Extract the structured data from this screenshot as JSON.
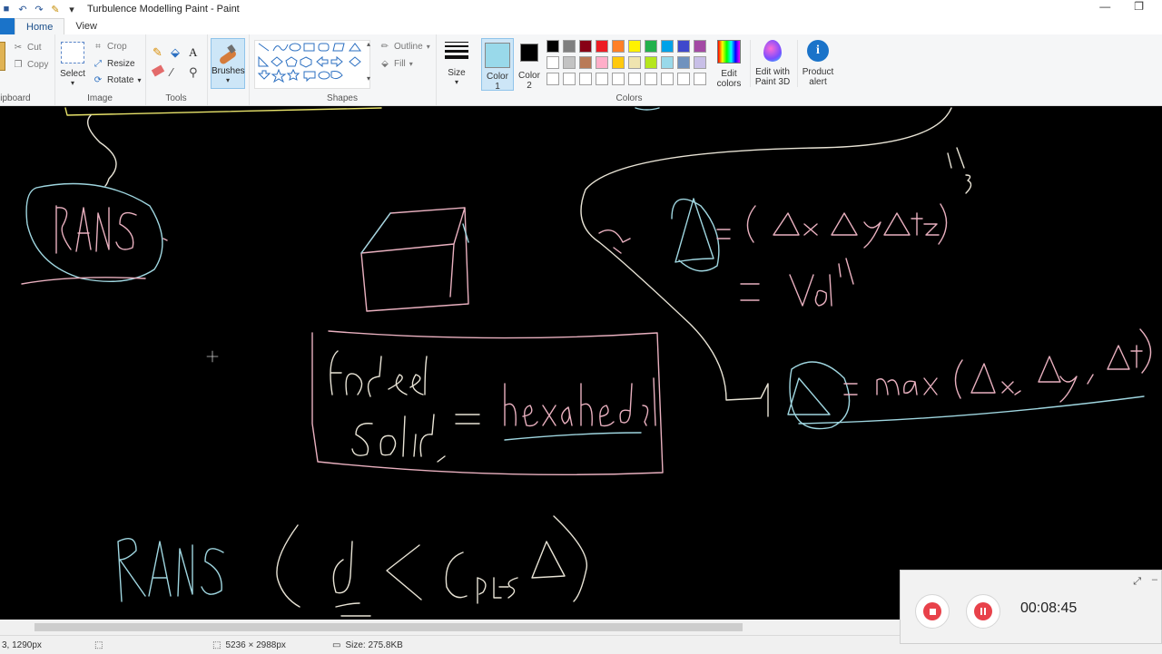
{
  "window": {
    "title": "Turbulence Modelling Paint - Paint",
    "min_glyph": "—",
    "restore_glyph": "❐"
  },
  "tabs": {
    "home": "Home",
    "view": "View"
  },
  "ribbon": {
    "clipboard": {
      "label": "lipboard"
    },
    "image": {
      "label": "Image",
      "select": "Select",
      "crop": "Crop",
      "resize": "Resize",
      "rotate": "Rotate",
      "cut": "Cut",
      "copy": "Copy"
    },
    "tools": {
      "label": "Tools",
      "text_glyph": "A"
    },
    "brushes": {
      "label": "Brushes"
    },
    "shapes": {
      "label": "Shapes",
      "outline": "Outline",
      "fill": "Fill"
    },
    "size": {
      "label": "Size"
    },
    "color1": {
      "line1": "Color",
      "line2": "1",
      "value": "#99d9ea"
    },
    "color2": {
      "line1": "Color",
      "line2": "2",
      "value": "#000000"
    },
    "colors": {
      "label": "Colors",
      "row1": [
        "#000000",
        "#7f7f7f",
        "#880015",
        "#ed1c24",
        "#ff7f27",
        "#fff200",
        "#22b14c",
        "#00a2e8",
        "#3f48cc",
        "#a349a4"
      ],
      "row2": [
        "#ffffff",
        "#c3c3c3",
        "#b97a57",
        "#ffaec9",
        "#ffc90e",
        "#efe4b0",
        "#b5e61d",
        "#99d9ea",
        "#7092be",
        "#c8bfe7"
      ],
      "row3": [
        "#ffffff",
        "#ffffff",
        "#ffffff",
        "#ffffff",
        "#ffffff",
        "#ffffff",
        "#ffffff",
        "#ffffff",
        "#ffffff",
        "#ffffff"
      ]
    },
    "edit_colors": {
      "line1": "Edit",
      "line2": "colors"
    },
    "paint3d": {
      "line1": "Edit with",
      "line2": "Paint 3D"
    },
    "product_alert": {
      "line1": "Product",
      "line2": "alert"
    }
  },
  "statusbar": {
    "cursor_pos": "3, 1290px",
    "dimensions": "5236 × 2988px",
    "size": "Size: 275.8KB"
  },
  "recorder": {
    "time": "00:08:45"
  }
}
